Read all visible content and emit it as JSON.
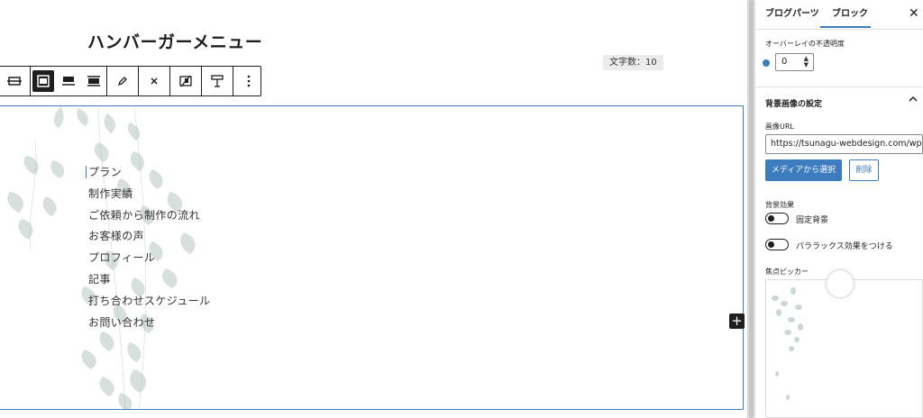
{
  "editor": {
    "title": "ハンバーガーメニュー",
    "word_count": "文字数：10",
    "menu_items": [
      "プラン",
      "制作実績",
      "ご依頼から制作の流れ",
      "お客様の声",
      "プロフィール",
      "記事",
      "打ち合わせスケジュール",
      "お問い合わせ"
    ],
    "add_block_symbol": "+"
  },
  "toolbar": {
    "icons": [
      "cover-block-icon",
      "align-content-top-icon",
      "align-content-center-icon",
      "full-height-icon",
      "pencil-icon",
      "close-icon",
      "image-switch-icon",
      "text-align-icon",
      "more-vertical-icon"
    ]
  },
  "sidebar": {
    "tabs": [
      "ブログパーツ",
      "ブロック"
    ],
    "close_symbol": "✕",
    "overlay_opacity_label": "オーバーレイの不透明度",
    "overlay_opacity_value": "0",
    "background_section_title": "背景画像の設定",
    "image_url_label": "画像URL",
    "image_url_value": "https://tsunagu-webdesign.com/wp-co",
    "media_button": "メディアから選択",
    "delete_button": "削除",
    "bg_effect_label": "背景効果",
    "fixed_bg_label": "固定背景",
    "parallax_label": "パララックス効果をつける",
    "focal_picker_label": "焦点ピッカー"
  },
  "colors": {
    "accent": "#3d7cbf",
    "dark": "#1e1e1e"
  }
}
